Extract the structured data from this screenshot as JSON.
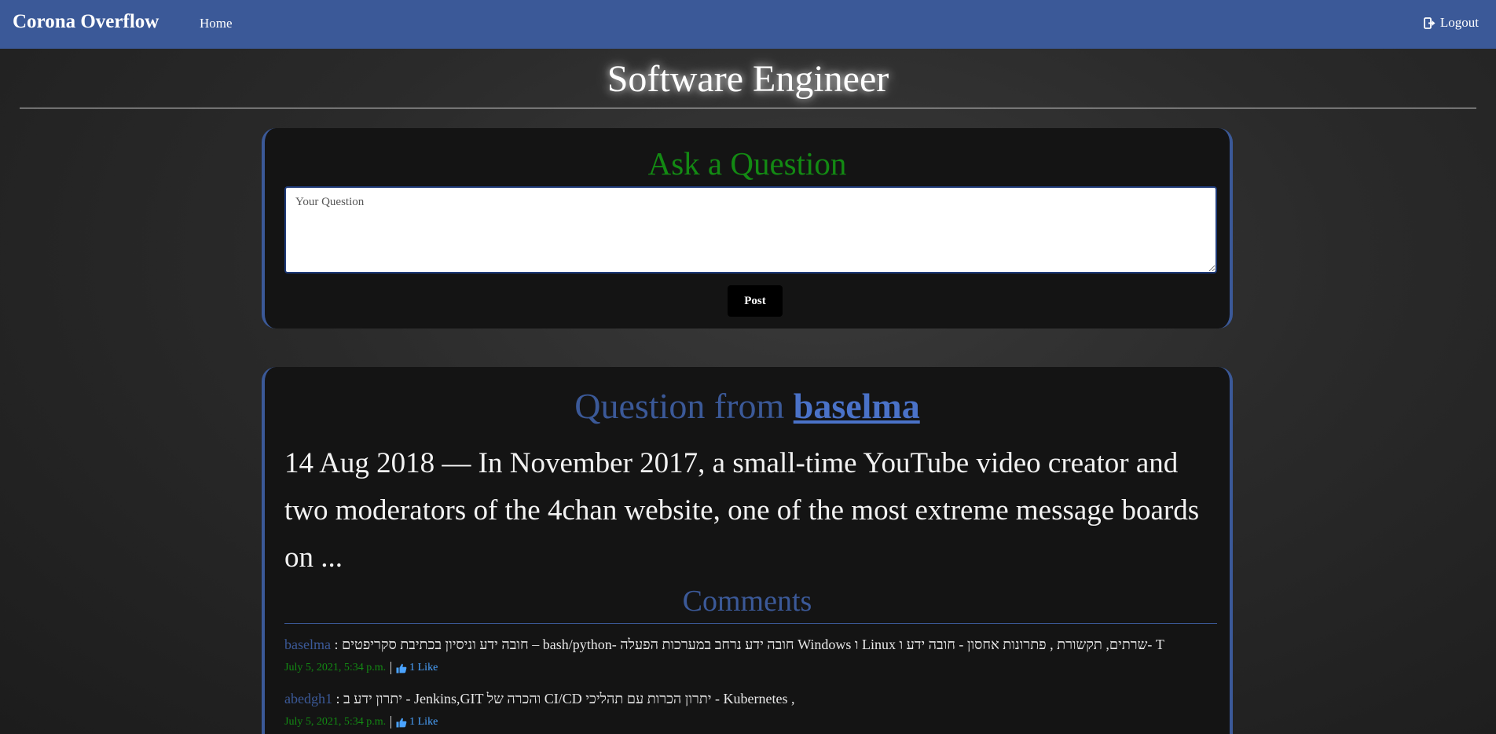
{
  "navbar": {
    "brand": "Corona Overflow",
    "home_label": "Home",
    "logout_label": "Logout",
    "logout_icon": "sign-out-icon",
    "background_color": "#3b5998"
  },
  "page": {
    "title": "Software Engineer"
  },
  "ask": {
    "heading": "Ask a Question",
    "placeholder": "Your Question",
    "post_label": "Post",
    "heading_color": "#138a13"
  },
  "question": {
    "heading_prefix": "Question from",
    "author": "baselma",
    "body": "14 Aug 2018 — In November 2017, a small-time YouTube video creator and two moderators of the 4chan website, one of the most extreme message boards on ...",
    "comments_heading": "Comments",
    "comments": [
      {
        "user": "baselma",
        "separator": ":",
        "text": "חובה ידע וניסיון בכתיבת סקריפטים – bash/python- חובה ידע נרחב במערכות הפעלה Windows ו Linux שרתים, תקשורת , פתרונות אחסון - חובה ידע ו- T",
        "date": "July 5, 2021, 5:34 p.m.",
        "likes": "1 Like",
        "like_icon": "thumbs-up-icon"
      },
      {
        "user": "abedgh1",
        "separator": ":",
        "text": "יתרון ידע ב - Jenkins,GIT והכרה של CI/CD יתרון הכרות עם תהליכי - Kubernetes ,",
        "date": "July 5, 2021, 5:34 p.m.",
        "likes": "1 Like",
        "like_icon": "thumbs-up-icon"
      }
    ]
  }
}
